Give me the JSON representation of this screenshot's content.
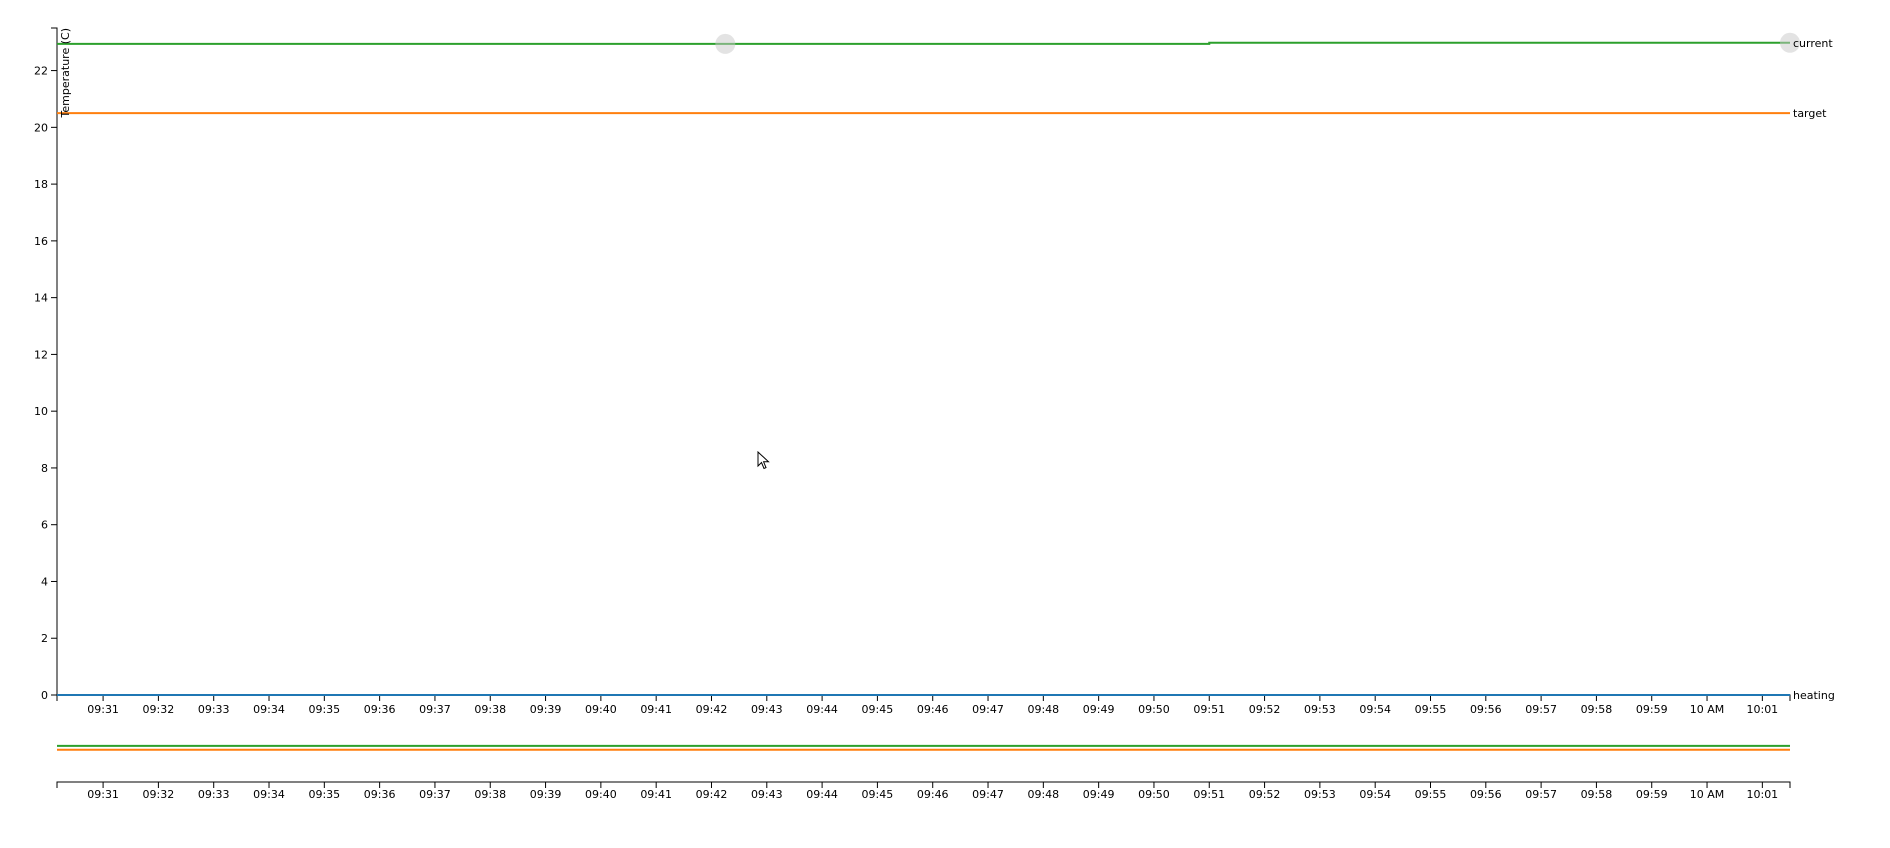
{
  "chart_data": {
    "type": "line",
    "ylabel": "Temperature (C)",
    "ylim": [
      0,
      23.5
    ],
    "yticks": [
      0,
      2,
      4,
      6,
      8,
      10,
      12,
      14,
      16,
      18,
      20,
      22
    ],
    "x_range": [
      "09:30:10",
      "10:01:30"
    ],
    "x_ticks": [
      {
        "time": "09:31",
        "label": "09:31"
      },
      {
        "time": "09:32",
        "label": "09:32"
      },
      {
        "time": "09:33",
        "label": "09:33"
      },
      {
        "time": "09:34",
        "label": "09:34"
      },
      {
        "time": "09:35",
        "label": "09:35"
      },
      {
        "time": "09:36",
        "label": "09:36"
      },
      {
        "time": "09:37",
        "label": "09:37"
      },
      {
        "time": "09:38",
        "label": "09:38"
      },
      {
        "time": "09:39",
        "label": "09:39"
      },
      {
        "time": "09:40",
        "label": "09:40"
      },
      {
        "time": "09:41",
        "label": "09:41"
      },
      {
        "time": "09:42",
        "label": "09:42"
      },
      {
        "time": "09:43",
        "label": "09:43"
      },
      {
        "time": "09:44",
        "label": "09:44"
      },
      {
        "time": "09:45",
        "label": "09:45"
      },
      {
        "time": "09:46",
        "label": "09:46"
      },
      {
        "time": "09:47",
        "label": "09:47"
      },
      {
        "time": "09:48",
        "label": "09:48"
      },
      {
        "time": "09:49",
        "label": "09:49"
      },
      {
        "time": "09:50",
        "label": "09:50"
      },
      {
        "time": "09:51",
        "label": "09:51"
      },
      {
        "time": "09:52",
        "label": "09:52"
      },
      {
        "time": "09:53",
        "label": "09:53"
      },
      {
        "time": "09:54",
        "label": "09:54"
      },
      {
        "time": "09:55",
        "label": "09:55"
      },
      {
        "time": "09:56",
        "label": "09:56"
      },
      {
        "time": "09:57",
        "label": "09:57"
      },
      {
        "time": "09:58",
        "label": "09:58"
      },
      {
        "time": "09:59",
        "label": "09:59"
      },
      {
        "time": "10:00",
        "label": "10 AM"
      },
      {
        "time": "10:01",
        "label": "10:01"
      }
    ],
    "series": [
      {
        "name": "current",
        "color": "#2ca02c",
        "points": [
          {
            "time": "09:30:10",
            "value": 22.94
          },
          {
            "time": "09:51:00",
            "value": 22.94
          },
          {
            "time": "09:51:00",
            "value": 22.98
          },
          {
            "time": "10:01:30",
            "value": 22.98
          }
        ],
        "markers": [
          {
            "time": "09:42:15",
            "value": 22.94
          },
          {
            "time": "10:01:30",
            "value": 22.98
          }
        ]
      },
      {
        "name": "target",
        "color": "#ff7f0e",
        "points": [
          {
            "time": "09:30:10",
            "value": 20.5
          },
          {
            "time": "10:01:30",
            "value": 20.5
          }
        ]
      },
      {
        "name": "heating",
        "color": "#1f77b4",
        "points": [
          {
            "time": "09:30:10",
            "value": 0
          },
          {
            "time": "10:01:30",
            "value": 0
          }
        ]
      }
    ],
    "overview": {
      "series": [
        {
          "name": "current",
          "color": "#2ca02c"
        },
        {
          "name": "target",
          "color": "#ff7f0e"
        }
      ]
    }
  }
}
